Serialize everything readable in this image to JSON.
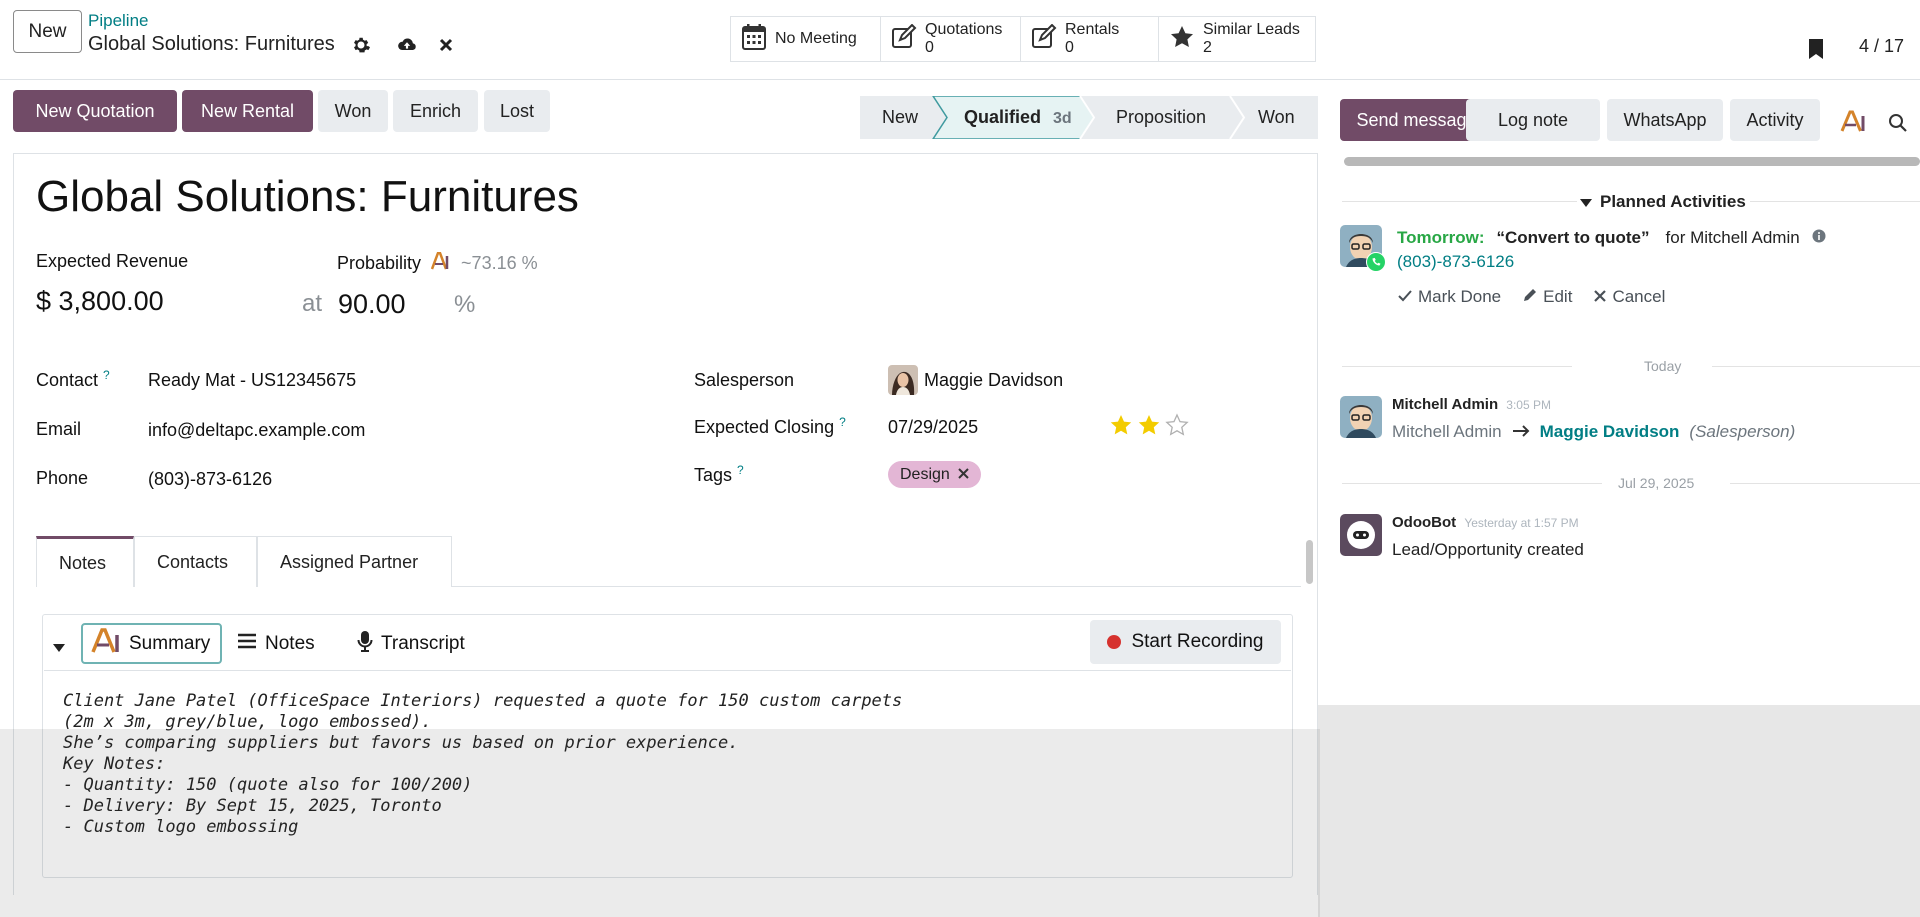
{
  "topbar": {
    "new_label": "New",
    "breadcrumb": "Pipeline",
    "record_title": "Global Solutions: Furnitures",
    "pager": "4 / 17",
    "smart_buttons": {
      "meeting": "No Meeting",
      "quotations_label": "Quotations",
      "quotations_count": "0",
      "rentals_label": "Rentals",
      "rentals_count": "0",
      "similar_label": "Similar Leads",
      "similar_count": "2"
    }
  },
  "actions": {
    "new_quotation": "New Quotation",
    "new_rental": "New Rental",
    "won": "Won",
    "enrich": "Enrich",
    "lost": "Lost"
  },
  "stages": {
    "items": [
      "New",
      "Qualified",
      "Proposition",
      "Won"
    ],
    "current": "Qualified",
    "current_days": "3d"
  },
  "form": {
    "title": "Global Solutions: Furnitures",
    "expected_revenue_label": "Expected Revenue",
    "expected_revenue": "$ 3,800.00",
    "at_label": "at",
    "probability_label": "Probability",
    "probability_ai": "~73.16 %",
    "probability": "90.00",
    "percent_sign": "%",
    "contact_label": "Contact",
    "contact": "Ready Mat - US12345675",
    "email_label": "Email",
    "email": "info@deltapc.example.com",
    "phone_label": "Phone",
    "phone": "(803)-873-6126",
    "salesperson_label": "Salesperson",
    "salesperson": "Maggie Davidson",
    "expected_closing_label": "Expected Closing",
    "expected_closing": "07/29/2025",
    "tags_label": "Tags",
    "tag": "Design",
    "priority_stars": 2,
    "priority_max": 3,
    "help_mark": "?"
  },
  "tabs": [
    "Notes",
    "Contacts",
    "Assigned Partner"
  ],
  "notes_widget": {
    "summary_label": "Summary",
    "notes_label": "Notes",
    "transcript_label": "Transcript",
    "record_label": "Start Recording",
    "lines": [
      "Client Jane Patel (OfficeSpace Interiors) requested a quote for 150 custom carpets",
      "(2m x 3m, grey/blue, logo embossed).",
      "She’s comparing suppliers but favors us based on prior experience.",
      "Key Notes:",
      "- Quantity: 150 (quote also for 100/200)",
      "- Delivery: By Sept 15, 2025, Toronto",
      "- Custom logo embossing"
    ]
  },
  "chatter": {
    "send_message": "Send message",
    "log_note": "Log note",
    "whatsapp": "WhatsApp",
    "activity": "Activity",
    "planned_activities": "Planned Activities",
    "activity_when": "Tomorrow:",
    "activity_summary": "“Convert to quote”",
    "activity_for": "for Mitchell Admin",
    "activity_phone": "(803)-873-6126",
    "mark_done": "Mark Done",
    "edit": "Edit",
    "cancel": "Cancel",
    "today": "Today",
    "msg1_author": "Mitchell Admin",
    "msg1_time": "3:05 PM",
    "msg1_from": "Mitchell Admin",
    "msg1_to": "Maggie Davidson",
    "msg1_field": "(Salesperson)",
    "date2": "Jul 29, 2025",
    "msg2_author": "OdooBot",
    "msg2_time": "Yesterday at 1:57 PM",
    "msg2_body": "Lead/Opportunity created"
  },
  "colors": {
    "primary": "#714b67",
    "teal": "#017e84",
    "green": "#28a745",
    "tag_bg": "#e3b6d5",
    "star": "#f3cc00"
  }
}
